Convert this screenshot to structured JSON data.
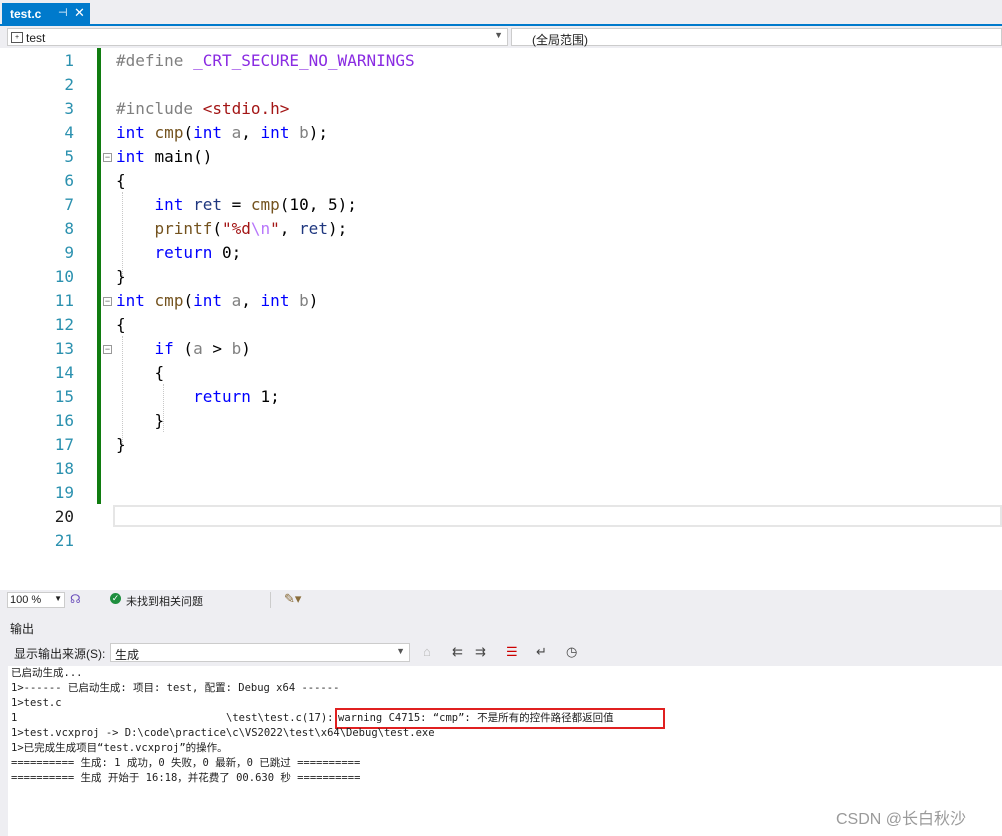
{
  "tab": {
    "title": "test.c",
    "pin": "⊣",
    "close": "✕"
  },
  "nav": {
    "scope_left": "test",
    "scope_right": "(全局范围)"
  },
  "editor": {
    "line_numbers": [
      "1",
      "2",
      "3",
      "4",
      "5",
      "6",
      "7",
      "8",
      "9",
      "10",
      "11",
      "12",
      "13",
      "14",
      "15",
      "16",
      "17",
      "18",
      "19",
      "20",
      "21"
    ],
    "current_line": "20"
  },
  "status": {
    "zoom": "100 %",
    "issues": "未找到相关问题"
  },
  "output": {
    "title": "输出",
    "source_label": "显示输出来源(S):",
    "source_value": "生成",
    "lines": [
      "已启动生成...",
      "1>------ 已启动生成: 项目: test, 配置: Debug x64 ------",
      "1>test.c",
      "1",
      "\\test\\test.c(17): ",
      "warning C4715: “cmp”: 不是所有的控件路径都返回值",
      "1>test.vcxproj -> D:\\code\\practice\\c\\VS2022\\test\\x64\\Debug\\test.exe",
      "1>已完成生成项目“test.vcxproj”的操作。",
      "========== 生成: 1 成功，0 失败，0 最新，0 已跳过 ==========",
      "========== 生成 开始于 16:18，并花费了 00.630 秒 =========="
    ]
  },
  "watermark": "CSDN @长白秋沙",
  "colors": {
    "accent": "#007acc",
    "change_bar": "#107c10",
    "keyword": "#0000ff",
    "warning_box": "#e02020"
  }
}
